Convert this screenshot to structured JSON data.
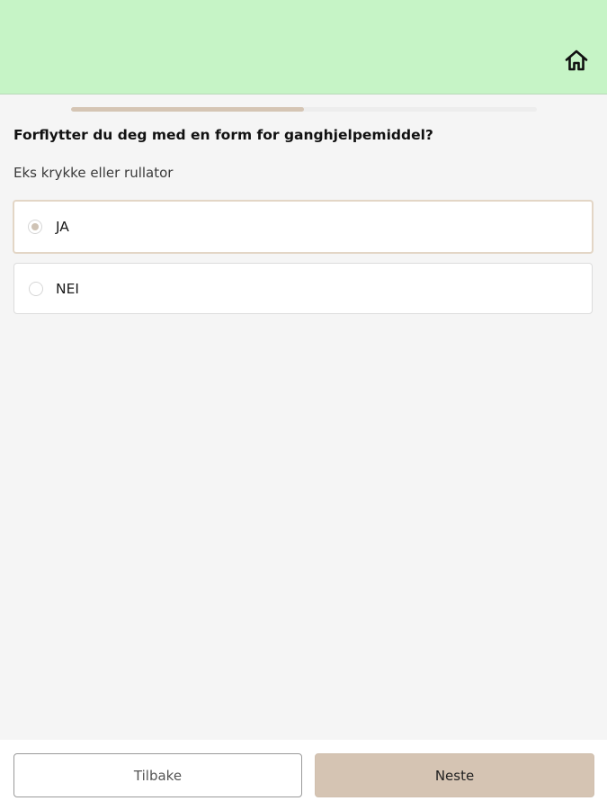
{
  "header": {
    "background_color": "#c6f4c6",
    "home_icon": "home-icon"
  },
  "progress": {
    "fraction": 0.5,
    "fill_color": "#d5c5b4"
  },
  "question": {
    "title": "Forflytter du deg med en form for ganghjelpemiddel?",
    "hint": "Eks krykke eller rullator"
  },
  "options": [
    {
      "label": "JA",
      "selected": true
    },
    {
      "label": "NEI",
      "selected": false
    }
  ],
  "footer": {
    "back_label": "Tilbake",
    "next_label": "Neste",
    "next_color": "#d5c4b3"
  }
}
